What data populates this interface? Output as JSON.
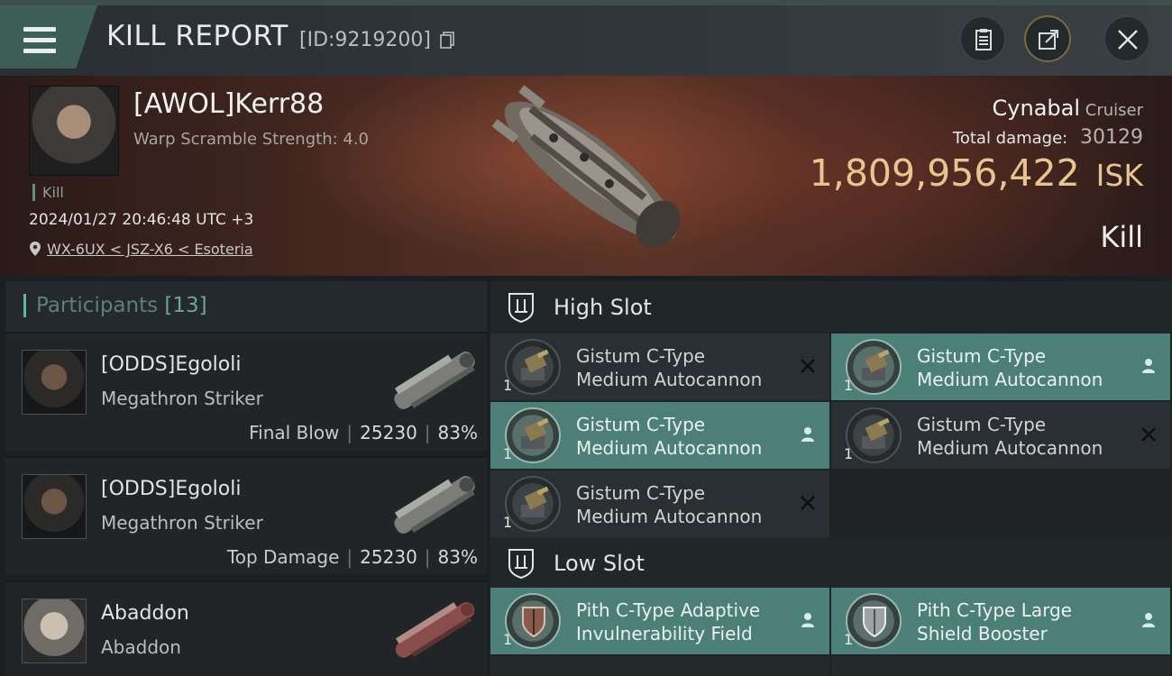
{
  "header": {
    "title": "KILL REPORT",
    "report_id": "[ID:9219200]"
  },
  "victim": {
    "name": "[AWOL]Kerr88",
    "warp_scramble": "Warp Scramble Strength: 4.0",
    "kill_tag": "Kill",
    "datetime": "2024/01/27 20:46:48 UTC +3",
    "location": "WX-6UX < JSZ-X6 < Esoteria",
    "ship_name": "Cynabal",
    "ship_class": "Cruiser",
    "total_damage_label": "Total damage:",
    "total_damage": "30129",
    "isk_value": "1,809,956,422",
    "isk_unit": "ISK",
    "result": "Kill"
  },
  "participants": {
    "label": "Participants",
    "count": "[13]",
    "rows": [
      {
        "name": "[ODDS]Egololi",
        "ship": "Megathron Striker",
        "role": "Final Blow",
        "damage": "25230",
        "percent": "83%"
      },
      {
        "name": "[ODDS]Egololi",
        "ship": "Megathron Striker",
        "role": "Top Damage",
        "damage": "25230",
        "percent": "83%"
      },
      {
        "name": "Abaddon",
        "ship": "Abaddon"
      }
    ]
  },
  "high_slot": {
    "title": "High Slot",
    "modules": [
      {
        "line1": "Gistum C-Type",
        "line2": "Medium Autocannon",
        "qty": "1",
        "state": "destroyed"
      },
      {
        "line1": "Gistum C-Type",
        "line2": "Medium Autocannon",
        "qty": "1",
        "state": "dropped"
      },
      {
        "line1": "Gistum C-Type",
        "line2": "Medium Autocannon",
        "qty": "1",
        "state": "dropped"
      },
      {
        "line1": "Gistum C-Type",
        "line2": "Medium Autocannon",
        "qty": "1",
        "state": "destroyed"
      },
      {
        "line1": "Gistum C-Type",
        "line2": "Medium Autocannon",
        "qty": "1",
        "state": "destroyed"
      }
    ]
  },
  "low_slot": {
    "title": "Low Slot",
    "modules": [
      {
        "line1": "Pith C-Type Adaptive",
        "line2": "Invulnerability Field",
        "qty": "1",
        "state": "dropped"
      },
      {
        "line1": "Pith C-Type Large",
        "line2": "Shield Booster",
        "qty": "1",
        "state": "dropped"
      }
    ]
  },
  "colors": {
    "accent": "#5fb7a3",
    "dropped_highlight": "#4c7f77",
    "isk_gold": "#e8c58e"
  }
}
